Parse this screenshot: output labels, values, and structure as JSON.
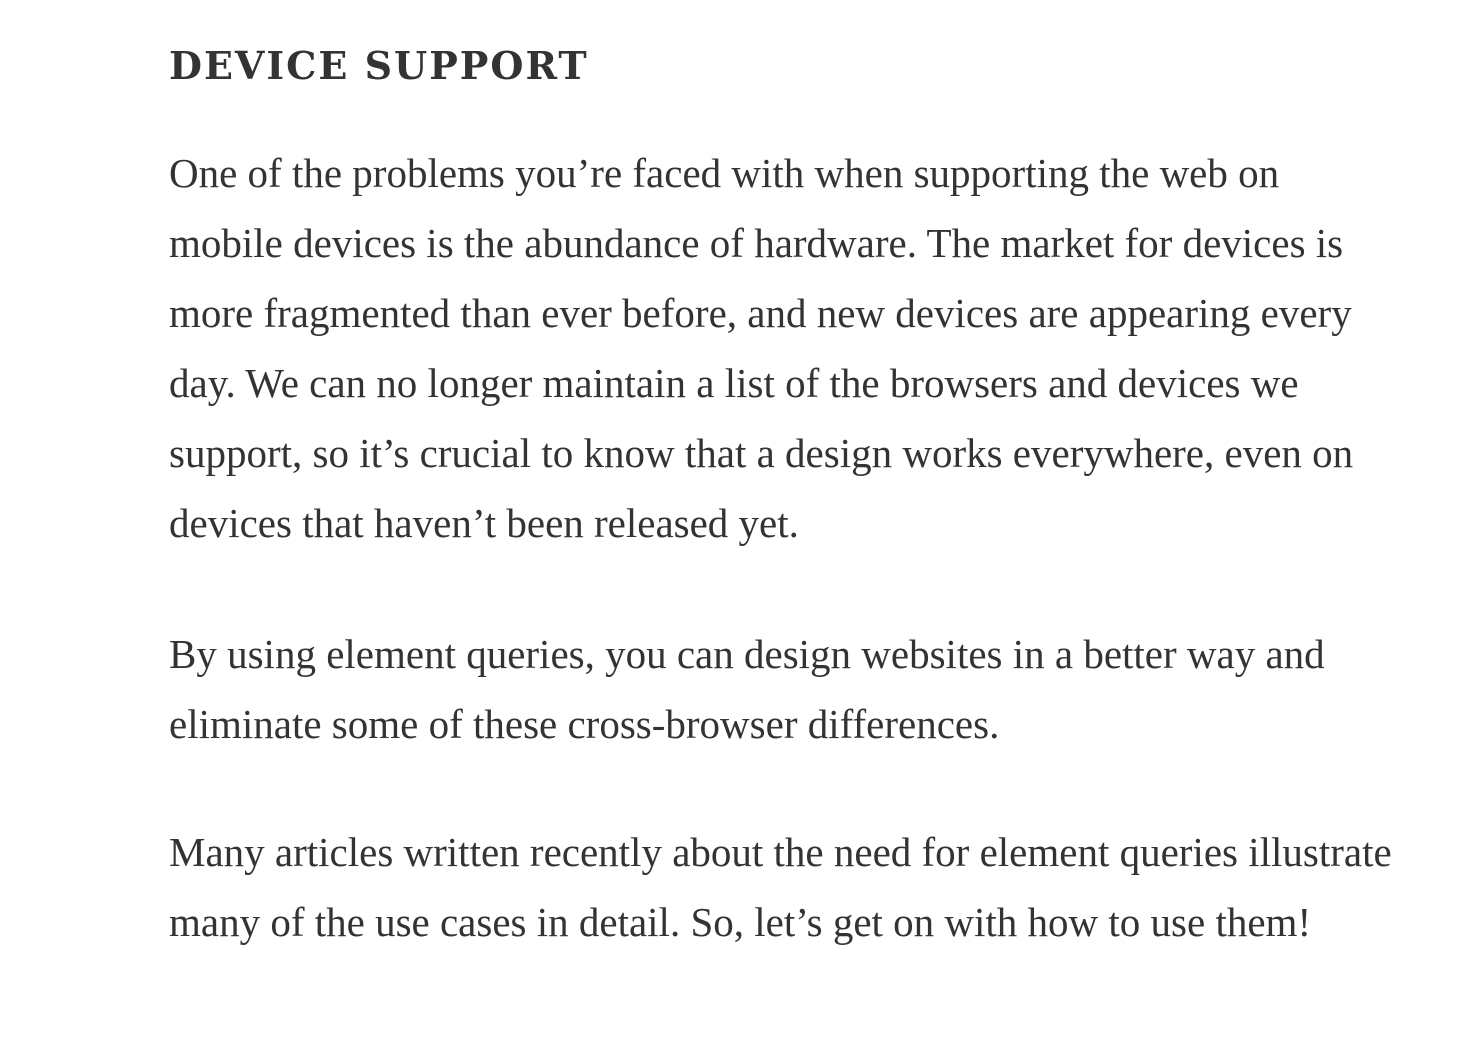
{
  "article": {
    "heading": "DEVICE SUPPORT",
    "paragraphs": [
      "One of the problems you’re faced with when supporting the web on mobile devices is the abundance of hardware. The market for devices is more fragmented than ever before, and new devices are appearing every day. We can no longer maintain a list of the browsers and devices we support, so it’s crucial to know that a design works everywhere, even on devices that haven’t been released yet.",
      "By using element queries, you can design websites in a better way and eliminate some of these cross-browser differences.",
      "Many articles written recently about the need for element queries illustrate many of the use cases in detail. So, let’s get on with how to use them!"
    ]
  }
}
